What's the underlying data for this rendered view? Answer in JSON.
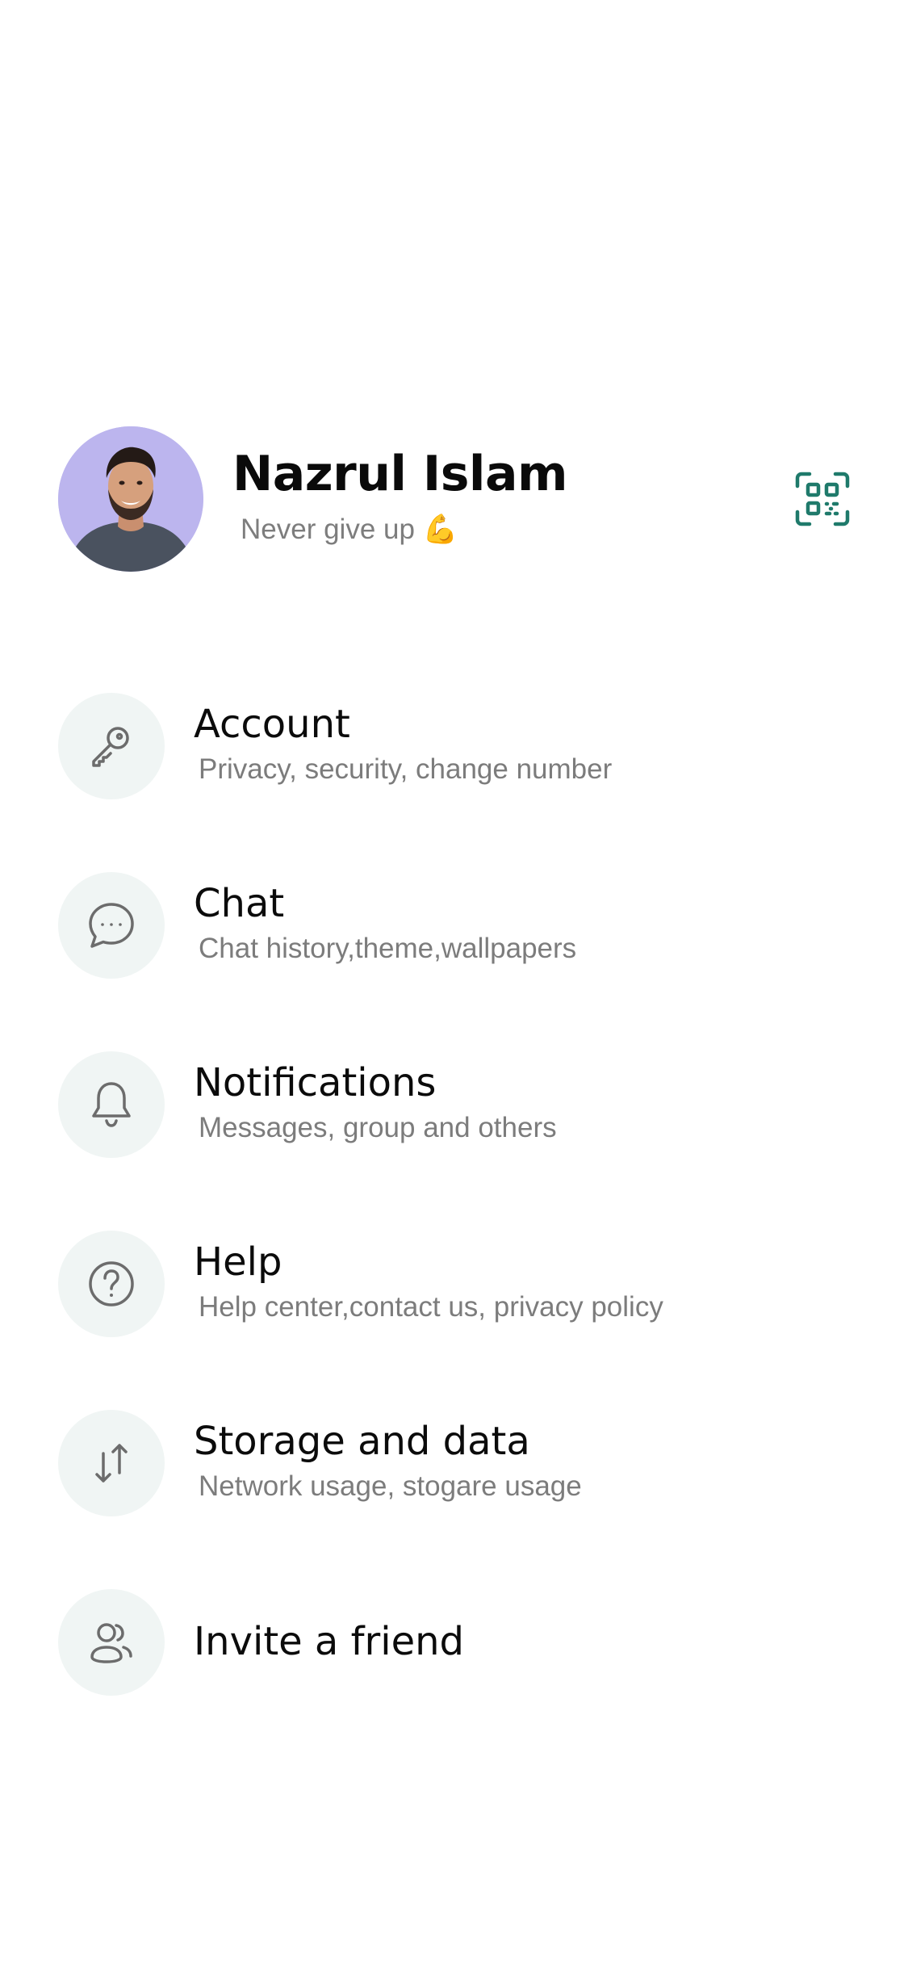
{
  "profile": {
    "name": "Nazrul Islam",
    "status": "Never give up 💪"
  },
  "colors": {
    "accent": "#1f7a6b",
    "icon_bg": "#f0f5f4",
    "subtitle": "#7c7c7c"
  },
  "menu": {
    "items": [
      {
        "icon": "key-icon",
        "title": "Account",
        "subtitle": "Privacy, security, change number"
      },
      {
        "icon": "chat-bubble-icon",
        "title": "Chat",
        "subtitle": "Chat history,theme,wallpapers"
      },
      {
        "icon": "bell-icon",
        "title": "Notifications",
        "subtitle": "Messages, group and others"
      },
      {
        "icon": "help-icon",
        "title": "Help",
        "subtitle": "Help center,contact us, privacy policy"
      },
      {
        "icon": "storage-arrows-icon",
        "title": "Storage and data",
        "subtitle": "Network usage, stogare usage"
      },
      {
        "icon": "invite-users-icon",
        "title": "Invite a friend"
      }
    ]
  }
}
